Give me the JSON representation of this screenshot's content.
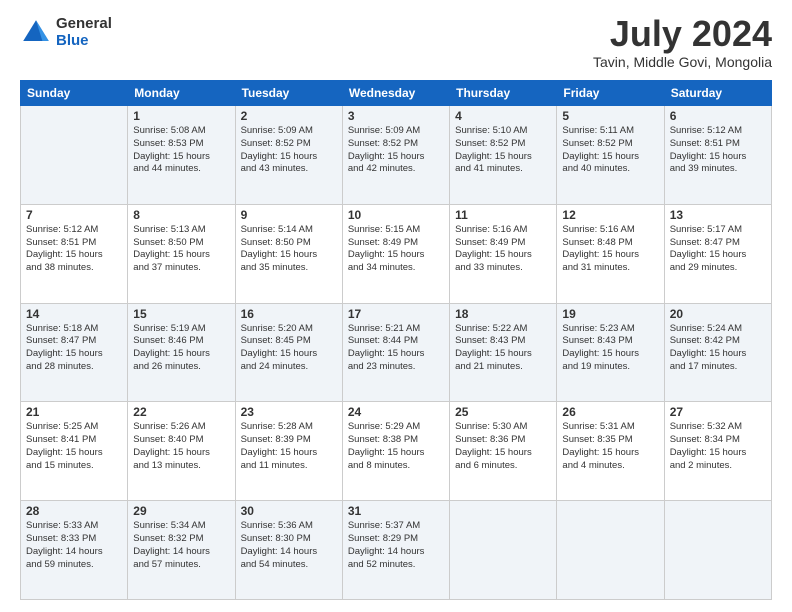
{
  "logo": {
    "general": "General",
    "blue": "Blue"
  },
  "title": "July 2024",
  "subtitle": "Tavin, Middle Govi, Mongolia",
  "calendar": {
    "headers": [
      "Sunday",
      "Monday",
      "Tuesday",
      "Wednesday",
      "Thursday",
      "Friday",
      "Saturday"
    ],
    "weeks": [
      [
        {
          "day": "",
          "info": ""
        },
        {
          "day": "1",
          "info": "Sunrise: 5:08 AM\nSunset: 8:53 PM\nDaylight: 15 hours\nand 44 minutes."
        },
        {
          "day": "2",
          "info": "Sunrise: 5:09 AM\nSunset: 8:52 PM\nDaylight: 15 hours\nand 43 minutes."
        },
        {
          "day": "3",
          "info": "Sunrise: 5:09 AM\nSunset: 8:52 PM\nDaylight: 15 hours\nand 42 minutes."
        },
        {
          "day": "4",
          "info": "Sunrise: 5:10 AM\nSunset: 8:52 PM\nDaylight: 15 hours\nand 41 minutes."
        },
        {
          "day": "5",
          "info": "Sunrise: 5:11 AM\nSunset: 8:52 PM\nDaylight: 15 hours\nand 40 minutes."
        },
        {
          "day": "6",
          "info": "Sunrise: 5:12 AM\nSunset: 8:51 PM\nDaylight: 15 hours\nand 39 minutes."
        }
      ],
      [
        {
          "day": "7",
          "info": "Sunrise: 5:12 AM\nSunset: 8:51 PM\nDaylight: 15 hours\nand 38 minutes."
        },
        {
          "day": "8",
          "info": "Sunrise: 5:13 AM\nSunset: 8:50 PM\nDaylight: 15 hours\nand 37 minutes."
        },
        {
          "day": "9",
          "info": "Sunrise: 5:14 AM\nSunset: 8:50 PM\nDaylight: 15 hours\nand 35 minutes."
        },
        {
          "day": "10",
          "info": "Sunrise: 5:15 AM\nSunset: 8:49 PM\nDaylight: 15 hours\nand 34 minutes."
        },
        {
          "day": "11",
          "info": "Sunrise: 5:16 AM\nSunset: 8:49 PM\nDaylight: 15 hours\nand 33 minutes."
        },
        {
          "day": "12",
          "info": "Sunrise: 5:16 AM\nSunset: 8:48 PM\nDaylight: 15 hours\nand 31 minutes."
        },
        {
          "day": "13",
          "info": "Sunrise: 5:17 AM\nSunset: 8:47 PM\nDaylight: 15 hours\nand 29 minutes."
        }
      ],
      [
        {
          "day": "14",
          "info": "Sunrise: 5:18 AM\nSunset: 8:47 PM\nDaylight: 15 hours\nand 28 minutes."
        },
        {
          "day": "15",
          "info": "Sunrise: 5:19 AM\nSunset: 8:46 PM\nDaylight: 15 hours\nand 26 minutes."
        },
        {
          "day": "16",
          "info": "Sunrise: 5:20 AM\nSunset: 8:45 PM\nDaylight: 15 hours\nand 24 minutes."
        },
        {
          "day": "17",
          "info": "Sunrise: 5:21 AM\nSunset: 8:44 PM\nDaylight: 15 hours\nand 23 minutes."
        },
        {
          "day": "18",
          "info": "Sunrise: 5:22 AM\nSunset: 8:43 PM\nDaylight: 15 hours\nand 21 minutes."
        },
        {
          "day": "19",
          "info": "Sunrise: 5:23 AM\nSunset: 8:43 PM\nDaylight: 15 hours\nand 19 minutes."
        },
        {
          "day": "20",
          "info": "Sunrise: 5:24 AM\nSunset: 8:42 PM\nDaylight: 15 hours\nand 17 minutes."
        }
      ],
      [
        {
          "day": "21",
          "info": "Sunrise: 5:25 AM\nSunset: 8:41 PM\nDaylight: 15 hours\nand 15 minutes."
        },
        {
          "day": "22",
          "info": "Sunrise: 5:26 AM\nSunset: 8:40 PM\nDaylight: 15 hours\nand 13 minutes."
        },
        {
          "day": "23",
          "info": "Sunrise: 5:28 AM\nSunset: 8:39 PM\nDaylight: 15 hours\nand 11 minutes."
        },
        {
          "day": "24",
          "info": "Sunrise: 5:29 AM\nSunset: 8:38 PM\nDaylight: 15 hours\nand 8 minutes."
        },
        {
          "day": "25",
          "info": "Sunrise: 5:30 AM\nSunset: 8:36 PM\nDaylight: 15 hours\nand 6 minutes."
        },
        {
          "day": "26",
          "info": "Sunrise: 5:31 AM\nSunset: 8:35 PM\nDaylight: 15 hours\nand 4 minutes."
        },
        {
          "day": "27",
          "info": "Sunrise: 5:32 AM\nSunset: 8:34 PM\nDaylight: 15 hours\nand 2 minutes."
        }
      ],
      [
        {
          "day": "28",
          "info": "Sunrise: 5:33 AM\nSunset: 8:33 PM\nDaylight: 14 hours\nand 59 minutes."
        },
        {
          "day": "29",
          "info": "Sunrise: 5:34 AM\nSunset: 8:32 PM\nDaylight: 14 hours\nand 57 minutes."
        },
        {
          "day": "30",
          "info": "Sunrise: 5:36 AM\nSunset: 8:30 PM\nDaylight: 14 hours\nand 54 minutes."
        },
        {
          "day": "31",
          "info": "Sunrise: 5:37 AM\nSunset: 8:29 PM\nDaylight: 14 hours\nand 52 minutes."
        },
        {
          "day": "",
          "info": ""
        },
        {
          "day": "",
          "info": ""
        },
        {
          "day": "",
          "info": ""
        }
      ]
    ]
  }
}
